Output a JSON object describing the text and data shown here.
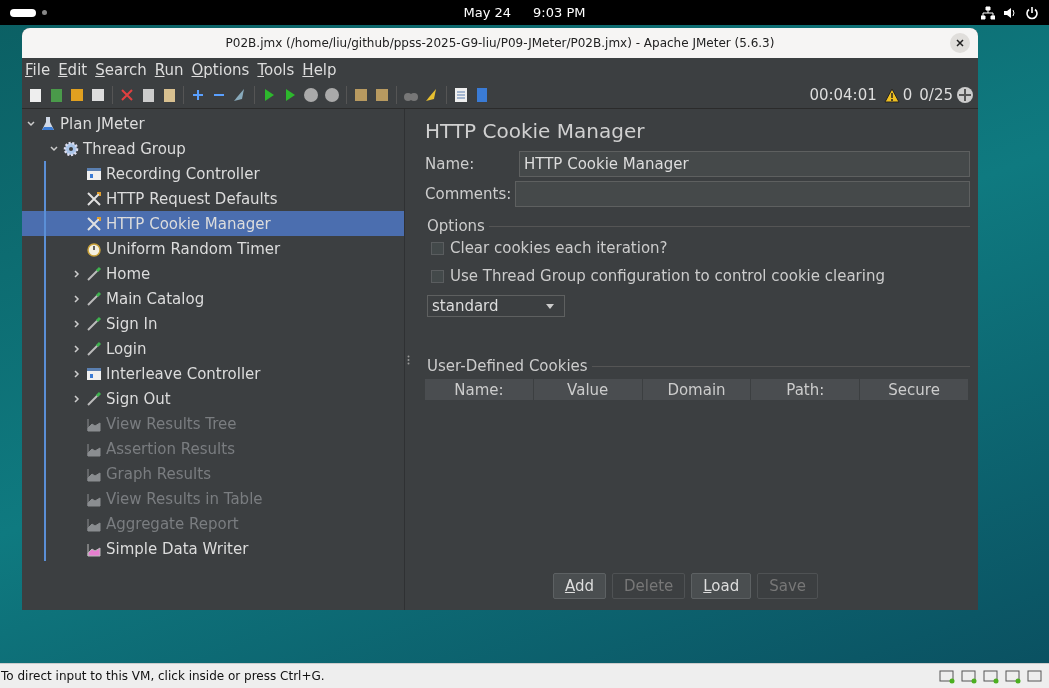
{
  "top_bar": {
    "date": "May 24",
    "time": "9:03 PM"
  },
  "window": {
    "title": "P02B.jmx (/home/liu/github/ppss-2025-G9-liu/P09-JMeter/P02B.jmx) - Apache JMeter (5.6.3)"
  },
  "menu": [
    "File",
    "Edit",
    "Search",
    "Run",
    "Options",
    "Tools",
    "Help"
  ],
  "toolbar": {
    "elapsed": "00:04:01",
    "warnings": "0",
    "threads": "0/25"
  },
  "tree": [
    {
      "label": "Plan JMeter",
      "kind": "plan",
      "expanded": true,
      "selected": false,
      "disabled": false,
      "children": [
        {
          "label": "Thread Group",
          "kind": "gear",
          "expanded": true,
          "selected": false,
          "disabled": false,
          "children": [
            {
              "label": "Recording Controller",
              "kind": "controller",
              "selected": false,
              "disabled": false
            },
            {
              "label": "HTTP Request Defaults",
              "kind": "config",
              "selected": false,
              "disabled": false
            },
            {
              "label": "HTTP Cookie Manager",
              "kind": "config",
              "selected": true,
              "disabled": false
            },
            {
              "label": "Uniform Random Timer",
              "kind": "timer",
              "selected": false,
              "disabled": false
            },
            {
              "label": "Home",
              "kind": "sampler",
              "expanded": false,
              "selected": false,
              "disabled": false
            },
            {
              "label": "Main Catalog",
              "kind": "sampler",
              "expanded": false,
              "selected": false,
              "disabled": false
            },
            {
              "label": "Sign In",
              "kind": "sampler",
              "expanded": false,
              "selected": false,
              "disabled": false
            },
            {
              "label": "Login",
              "kind": "sampler",
              "expanded": false,
              "selected": false,
              "disabled": false
            },
            {
              "label": "Interleave Controller",
              "kind": "controller",
              "expanded": false,
              "selected": false,
              "disabled": false
            },
            {
              "label": "Sign Out",
              "kind": "sampler",
              "expanded": false,
              "selected": false,
              "disabled": false
            },
            {
              "label": "View Results Tree",
              "kind": "listener",
              "selected": false,
              "disabled": true
            },
            {
              "label": "Assertion Results",
              "kind": "listener",
              "selected": false,
              "disabled": true
            },
            {
              "label": "Graph Results",
              "kind": "listener",
              "selected": false,
              "disabled": true
            },
            {
              "label": "View Results in Table",
              "kind": "listener",
              "selected": false,
              "disabled": true
            },
            {
              "label": "Aggregate Report",
              "kind": "listener",
              "selected": false,
              "disabled": true
            },
            {
              "label": "Simple Data Writer",
              "kind": "writer",
              "selected": false,
              "disabled": false
            }
          ]
        }
      ]
    }
  ],
  "panel": {
    "title": "HTTP Cookie Manager",
    "name_label": "Name:",
    "name_value": "HTTP Cookie Manager",
    "comments_label": "Comments:",
    "options_title": "Options",
    "options": [
      {
        "label": "Clear cookies each iteration?",
        "checked": false
      },
      {
        "label": "Use Thread Group configuration to control cookie clearing",
        "checked": false
      }
    ],
    "policy": "standard",
    "cookies_title": "User-Defined Cookies",
    "columns": [
      "Name:",
      "Value",
      "Domain",
      "Path:",
      "Secure"
    ],
    "buttons": [
      {
        "label": "Add",
        "disabled": false
      },
      {
        "label": "Delete",
        "disabled": true
      },
      {
        "label": "Load",
        "disabled": false
      },
      {
        "label": "Save",
        "disabled": true
      }
    ]
  },
  "vm_bar": {
    "message": "To direct input to this VM, click inside or press Ctrl+G."
  }
}
